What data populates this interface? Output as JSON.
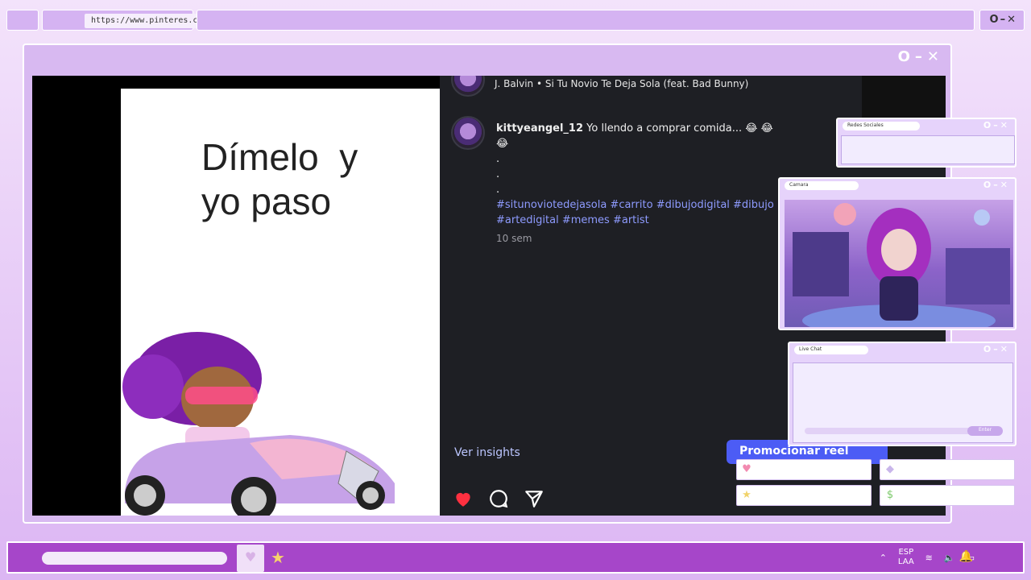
{
  "browser": {
    "url": "https://www.pinteres.com/",
    "controls": "O–✕"
  },
  "main_window": {
    "controls": "O–✕"
  },
  "video": {
    "meme_text": "Dímelo  y\nyo paso"
  },
  "post": {
    "song": "J. Balvin • Si Tu Novio Te Deja Sola (feat. Bad Bunny)",
    "username": "kittyeangel_12",
    "comment_text": " Yo llendo a comprar comida... 😂 😂 😂",
    "dots": [
      ".",
      ".",
      "."
    ],
    "hashtags": "#situnoviotedejasola #carrito #dibujodigital #dibujo #artedigital #memes #artist",
    "time_ago": "10 sem",
    "insights_label": "Ver insights",
    "promote_label": "Promocionar reel"
  },
  "overlays": {
    "social": {
      "title": "Redes Sociales"
    },
    "camera": {
      "title": "Camara"
    },
    "live_chat": {
      "title": "Live Chat",
      "enter_label": "Enter"
    }
  },
  "taskbar": {
    "lang_top": "ESP",
    "lang_bottom": "LAA"
  },
  "colors": {
    "accent_purple": "#a646c9",
    "promo_blue": "#4c5cf5",
    "like_red": "#ff3040",
    "hashtag_blue": "#8e9bff"
  }
}
